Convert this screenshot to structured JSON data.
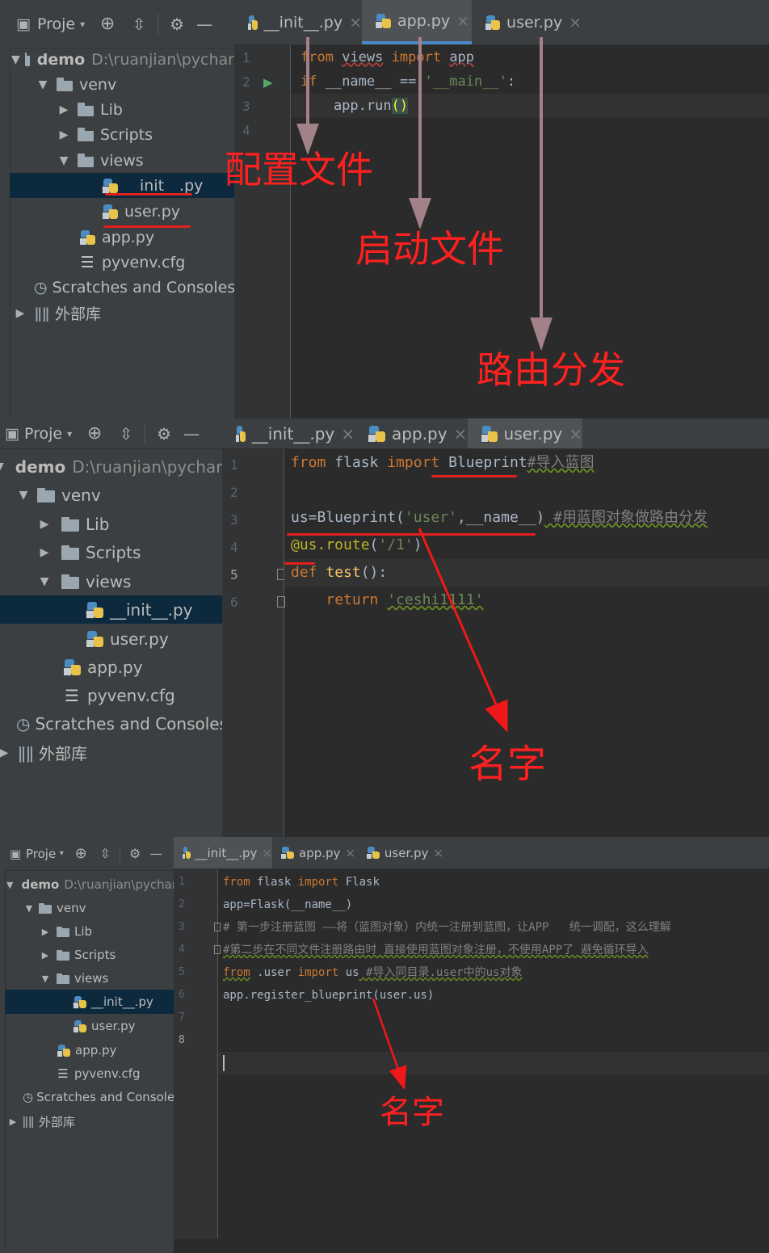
{
  "panel1": {
    "project": {
      "title": "Proje",
      "tree": [
        {
          "label": "demo",
          "path": "D:\\ruanjian\\pychar"
        },
        {
          "label": "venv"
        },
        {
          "label": "Lib"
        },
        {
          "label": "Scripts"
        },
        {
          "label": "views"
        },
        {
          "label": "__init__.py"
        },
        {
          "label": "user.py"
        },
        {
          "label": "app.py"
        },
        {
          "label": "pyvenv.cfg"
        },
        {
          "label": "Scratches and Consoles"
        },
        {
          "label": "外部库"
        }
      ]
    },
    "tabs": [
      {
        "label": "__init__.py"
      },
      {
        "label": "app.py"
      },
      {
        "label": "user.py"
      }
    ],
    "line_numbers": [
      "1",
      "2",
      "3",
      "4"
    ],
    "code": {
      "l1": {
        "a": "from",
        "b": " ",
        "c": "views",
        "d": " ",
        "e": "import",
        "f": " ",
        "g": "app"
      },
      "l2": {
        "a": "if",
        "b": " __name__ == ",
        "c": "'__main__'",
        "d": ":"
      },
      "l3": {
        "a": "    app.run",
        "b": "()"
      }
    },
    "annotations": {
      "config": "配置文件",
      "startup": "启动文件",
      "routing": "路由分发"
    }
  },
  "panel2": {
    "project": {
      "title": "Proje",
      "tree": [
        {
          "label": "demo",
          "path": "D:\\ruanjian\\pychar"
        },
        {
          "label": "venv"
        },
        {
          "label": "Lib"
        },
        {
          "label": "Scripts"
        },
        {
          "label": "views"
        },
        {
          "label": "__init__.py"
        },
        {
          "label": "user.py"
        },
        {
          "label": "app.py"
        },
        {
          "label": "pyvenv.cfg"
        },
        {
          "label": "Scratches and Consoles"
        },
        {
          "label": "外部库"
        }
      ]
    },
    "tabs": [
      {
        "label": "__init__.py"
      },
      {
        "label": "app.py"
      },
      {
        "label": "user.py"
      }
    ],
    "line_numbers": [
      "1",
      "2",
      "3",
      "4",
      "5",
      "6"
    ],
    "code": {
      "l1": {
        "a": "from",
        "b": " flask ",
        "c": "import",
        "d": " Blueprint",
        "e": "#导入蓝图"
      },
      "l3": {
        "a": "us=Blueprint(",
        "b": "'user'",
        "c": ",__name__)",
        "d": " #用蓝图对象做路由分发"
      },
      "l4": {
        "a": "@us.route",
        "b": "(",
        "c": "'/1'",
        "d": ")"
      },
      "l5": {
        "a": "def",
        "b": " ",
        "c": "test",
        "d": "():"
      },
      "l6": {
        "a": "    ",
        "b": "return",
        "c": " ",
        "d": "'ceshi1111'"
      }
    },
    "annotations": {
      "name": "名字"
    }
  },
  "panel3": {
    "project": {
      "title": "Proje",
      "tree": [
        {
          "label": "demo",
          "path": "D:\\ruanjian\\pychar"
        },
        {
          "label": "venv"
        },
        {
          "label": "Lib"
        },
        {
          "label": "Scripts"
        },
        {
          "label": "views"
        },
        {
          "label": "__init__.py"
        },
        {
          "label": "user.py"
        },
        {
          "label": "app.py"
        },
        {
          "label": "pyvenv.cfg"
        },
        {
          "label": "Scratches and Consoles"
        },
        {
          "label": "外部库"
        }
      ]
    },
    "tabs": [
      {
        "label": "__init__.py"
      },
      {
        "label": "app.py"
      },
      {
        "label": "user.py"
      }
    ],
    "line_numbers": [
      "1",
      "2",
      "3",
      "4",
      "5",
      "6",
      "7",
      "8"
    ],
    "code": {
      "l1": {
        "a": "from",
        "b": " flask ",
        "c": "import",
        "d": " Flask"
      },
      "l2": {
        "a": "app=Flask(__name__)"
      },
      "l3": {
        "a": "# 第一步注册蓝图 ——将（蓝图对象）内统一注册到蓝图，让APP   统一调配，这么理解"
      },
      "l4": {
        "a": "#第二步在不同文件注册路由时 直接使用蓝图对象注册，不使用APP了 避免循环导入"
      },
      "l5": {
        "a": "from",
        "b": " .user ",
        "c": "import",
        "d": " us",
        "e": " #导入同目录.user中的us对象"
      },
      "l6": {
        "a": "app.register_blueprint(user.us)"
      }
    },
    "annotations": {
      "name": "名字"
    }
  }
}
